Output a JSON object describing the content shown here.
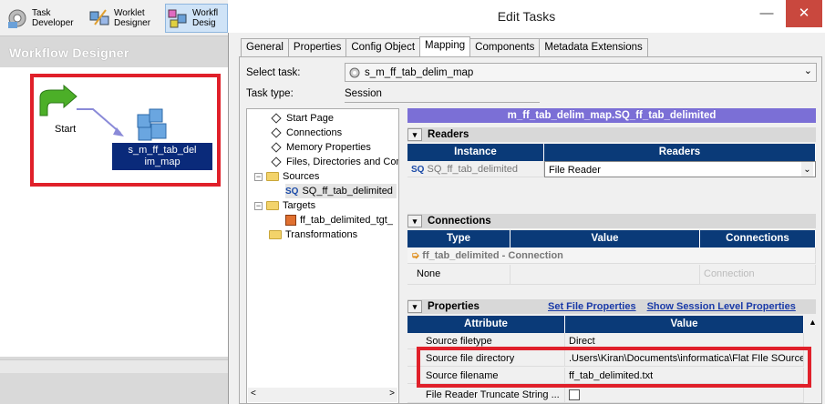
{
  "toolbar": {
    "task_developer": "Task\nDeveloper",
    "worklet_designer": "Worklet\nDesigner",
    "workflow_designer": "Workfl\nDesig"
  },
  "designer": {
    "title": "Workflow Designer",
    "start_label": "Start",
    "session_label": "s_m_ff_tab_del im_map"
  },
  "dialog": {
    "title": "Edit Tasks",
    "tabs": [
      "General",
      "Properties",
      "Config Object",
      "Mapping",
      "Components",
      "Metadata Extensions"
    ],
    "selected_tab": "Mapping",
    "select_task_label": "Select task:",
    "select_task_value": "s_m_ff_tab_delim_map",
    "task_type_label": "Task type:",
    "task_type_value": "Session"
  },
  "tree": {
    "items": [
      {
        "label": "Start Page"
      },
      {
        "label": "Connections"
      },
      {
        "label": "Memory Properties"
      },
      {
        "label": "Files, Directories and Com"
      },
      {
        "label": "Sources"
      },
      {
        "label": "SQ_ff_tab_delimited"
      },
      {
        "label": "Targets"
      },
      {
        "label": "ff_tab_delimited_tgt_"
      },
      {
        "label": "Transformations"
      }
    ]
  },
  "mapping": {
    "header": "m_ff_tab_delim_map.SQ_ff_tab_delimited",
    "readers": {
      "section": "Readers",
      "col_instance": "Instance",
      "col_readers": "Readers",
      "instance": "SQ_ff_tab_delimited",
      "reader": "File Reader"
    },
    "connections": {
      "section": "Connections",
      "col_type": "Type",
      "col_value": "Value",
      "col_connections": "Connections",
      "group": "ff_tab_delimited - Connection",
      "type": "None",
      "connection_placeholder": "Connection"
    },
    "properties": {
      "section": "Properties",
      "set_file": "Set File Properties",
      "show_session": "Show Session Level Properties",
      "col_attribute": "Attribute",
      "col_value": "Value",
      "rows": [
        {
          "attr": "Source filetype",
          "value": "Direct"
        },
        {
          "attr": "Source file directory",
          "value": ".Users\\Kiran\\Documents\\informatica\\Flat FIle SOurce\\"
        },
        {
          "attr": "Source filename",
          "value": "ff_tab_delimited.txt"
        },
        {
          "attr": "File Reader Truncate String ...",
          "value": ""
        }
      ]
    }
  }
}
